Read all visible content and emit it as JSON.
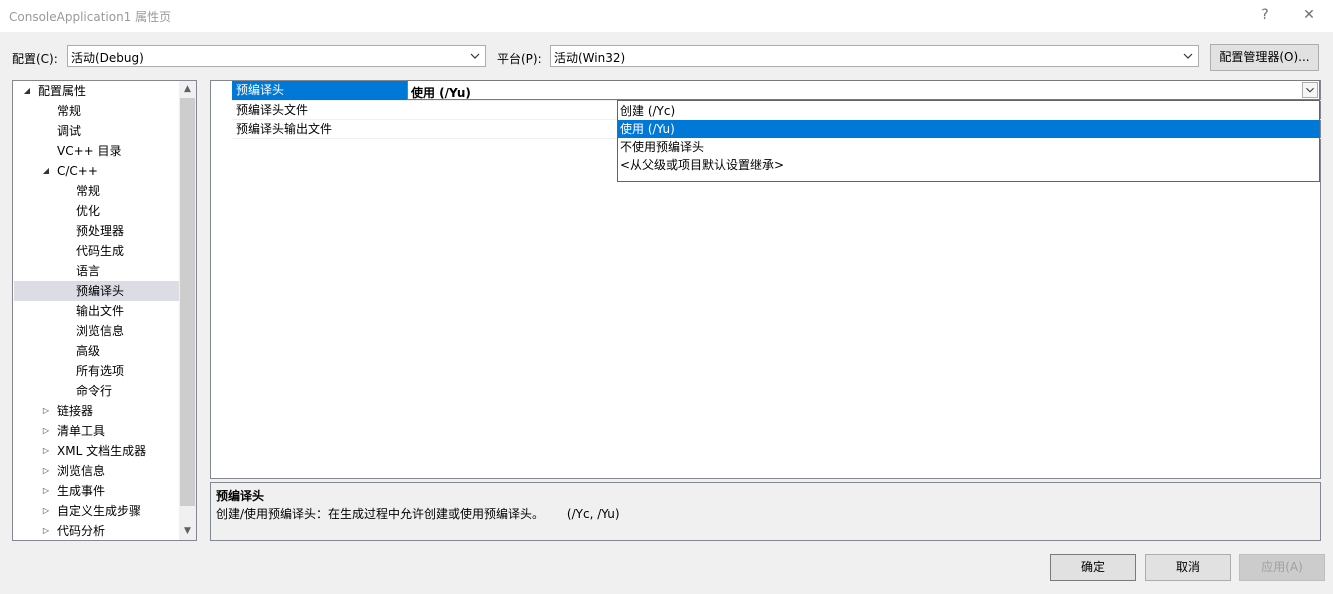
{
  "window": {
    "title": "ConsoleApplication1 属性页",
    "help_label": "?",
    "close_label": "✕"
  },
  "config": {
    "label": "配置(C):",
    "value": "活动(Debug)"
  },
  "platform": {
    "label": "平台(P):",
    "value": "活动(Win32)"
  },
  "config_manager_label": "配置管理器(O)...",
  "tree": {
    "items": [
      {
        "label": "配置属性",
        "expander": "◢"
      },
      {
        "label": "常规",
        "expander": ""
      },
      {
        "label": "调试",
        "expander": ""
      },
      {
        "label": "VC++ 目录",
        "expander": ""
      },
      {
        "label": "C/C++",
        "expander": "◢"
      },
      {
        "label": "常规",
        "expander": ""
      },
      {
        "label": "优化",
        "expander": ""
      },
      {
        "label": "预处理器",
        "expander": ""
      },
      {
        "label": "代码生成",
        "expander": ""
      },
      {
        "label": "语言",
        "expander": ""
      },
      {
        "label": "预编译头",
        "expander": ""
      },
      {
        "label": "输出文件",
        "expander": ""
      },
      {
        "label": "浏览信息",
        "expander": ""
      },
      {
        "label": "高级",
        "expander": ""
      },
      {
        "label": "所有选项",
        "expander": ""
      },
      {
        "label": "命令行",
        "expander": ""
      },
      {
        "label": "链接器",
        "expander": "▷"
      },
      {
        "label": "清单工具",
        "expander": "▷"
      },
      {
        "label": "XML 文档生成器",
        "expander": "▷"
      },
      {
        "label": "浏览信息",
        "expander": "▷"
      },
      {
        "label": "生成事件",
        "expander": "▷"
      },
      {
        "label": "自定义生成步骤",
        "expander": "▷"
      },
      {
        "label": "代码分析",
        "expander": "▷"
      }
    ],
    "selected": "预编译头"
  },
  "grid": {
    "properties": [
      {
        "name": "预编译头"
      },
      {
        "name": "预编译头文件"
      },
      {
        "name": "预编译头输出文件"
      }
    ],
    "current_value": "使用 (/Yu)",
    "dropdown_options": [
      {
        "label": "创建 (/Yc)"
      },
      {
        "label": "使用 (/Yu)"
      },
      {
        "label": "不使用预编译头"
      },
      {
        "label": "<从父级或项目默认设置继承>"
      }
    ]
  },
  "description": {
    "title": "预编译头",
    "text": "创建/使用预编译头：在生成过程中允许创建或使用预编译头。      (/Yc, /Yu)"
  },
  "buttons": {
    "ok": "确定",
    "cancel": "取消",
    "apply": "应用(A)"
  },
  "colors": {
    "selection": "#0078d7",
    "tree_selection": "#dcdce4",
    "window_bg": "#f0f0f0"
  }
}
